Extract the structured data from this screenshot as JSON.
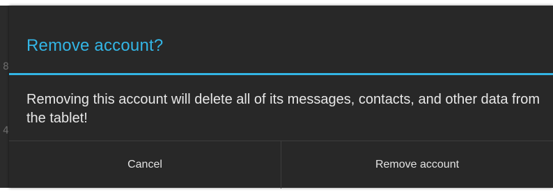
{
  "background": {
    "digits": [
      "8",
      "4"
    ]
  },
  "dialog": {
    "title": "Remove account?",
    "message": "Removing this account will delete all of its messages, contacts, and other data from the tablet!",
    "buttons": {
      "cancel": "Cancel",
      "confirm": "Remove account"
    }
  },
  "colors": {
    "accent": "#33b5e5",
    "dialog_background": "#282828",
    "text": "#e8e8e8"
  }
}
